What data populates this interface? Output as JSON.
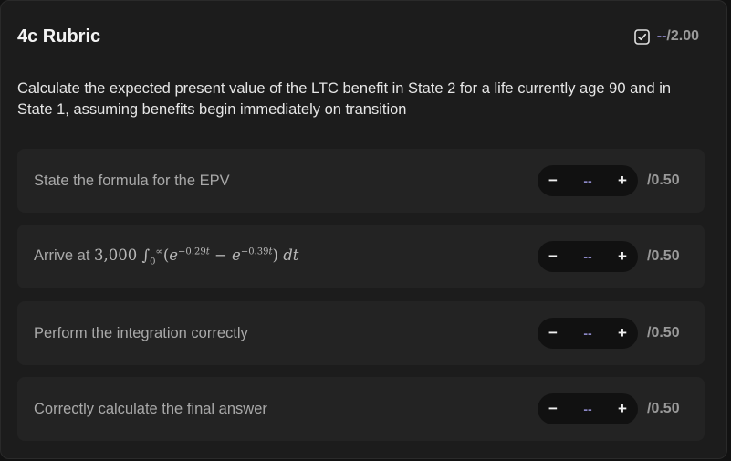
{
  "header": {
    "title": "4c Rubric",
    "score_dash": "--",
    "score_max": "/2.00"
  },
  "question": "Calculate the expected present value of the LTC benefit in State 2 for a life currently age 90 and in State 1, assuming benefits begin immediately on transition",
  "criteria": [
    {
      "label": "State the formula for the EPV",
      "value": "--",
      "points": "/0.50"
    },
    {
      "label_prefix": "Arrive at",
      "formula": "3,000 ∫₀^∞ (e^{−0.29t} − e^{−0.39t}) dt",
      "value": "--",
      "points": "/0.50"
    },
    {
      "label": "Perform the integration correctly",
      "value": "--",
      "points": "/0.50"
    },
    {
      "label": "Correctly calculate the final answer",
      "value": "--",
      "points": "/0.50"
    }
  ],
  "controls": {
    "minus": "−",
    "plus": "+"
  },
  "colors": {
    "accent": "#8c88c8",
    "card": "#232323",
    "panel": "#1c1c1c"
  },
  "icons": {
    "header_status": "checkbox-check-icon"
  }
}
